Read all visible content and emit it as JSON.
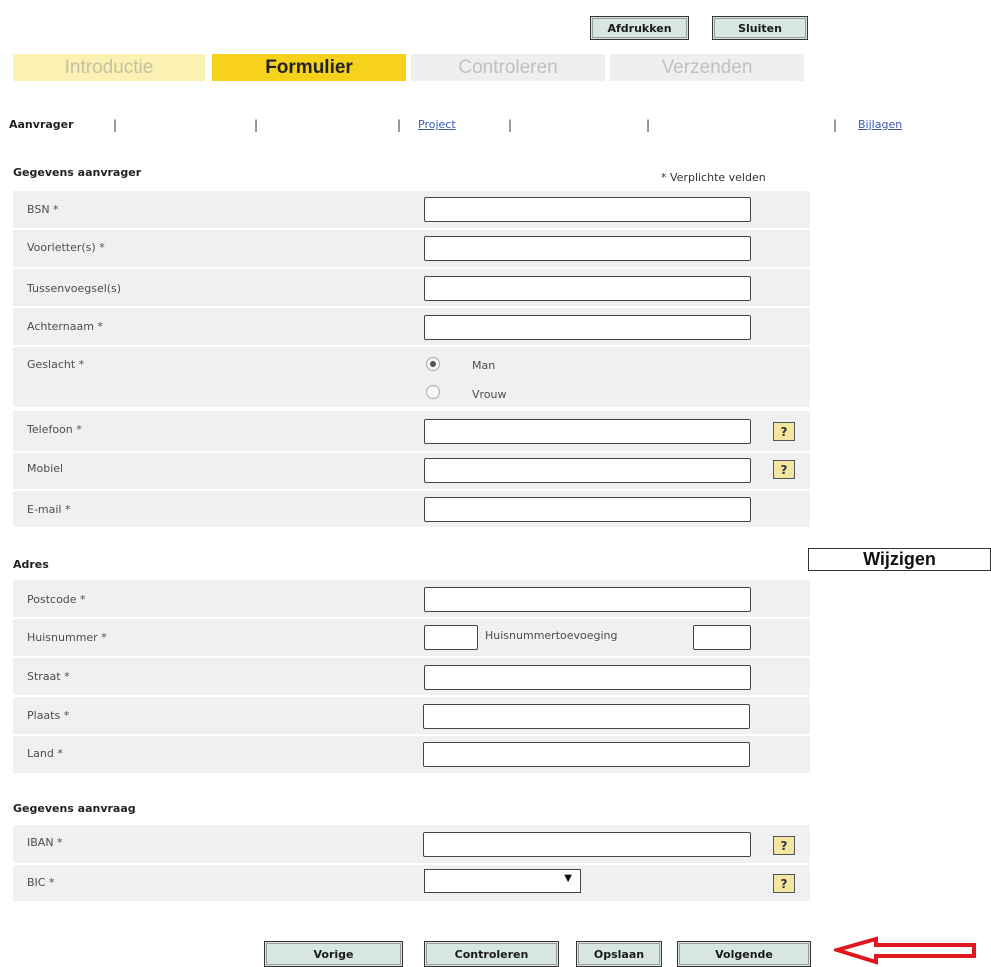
{
  "toolbar": {
    "print_label": "Afdrukken",
    "close_label": "Sluiten"
  },
  "steps": {
    "intro": "Introductie",
    "form": "Formulier",
    "check": "Controleren",
    "send": "Verzenden"
  },
  "subnav": {
    "applicant": "Aanvrager",
    "project": "Project",
    "attachments": "Bijlagen"
  },
  "section_applicant": {
    "title": "Gegevens aanvrager",
    "required_note": "* Verplichte velden",
    "bsn": "BSN *",
    "initials": "Voorletter(s) *",
    "prefix": "Tussenvoegsel(s)",
    "surname": "Achternaam *",
    "gender": "Geslacht *",
    "gender_male": "Man",
    "gender_female": "Vrouw",
    "phone": "Telefoon *",
    "mobile": "Mobiel",
    "email": "E-mail *"
  },
  "section_address": {
    "title": "Adres",
    "change_label": "Wijzigen",
    "postcode": "Postcode *",
    "house_number": "Huisnummer *",
    "house_number_addition": "Huisnummertoevoeging",
    "street": "Straat *",
    "city": "Plaats *",
    "country": "Land *"
  },
  "section_request": {
    "title": "Gegevens aanvraag",
    "iban": "IBAN *",
    "bic": "BIC *"
  },
  "help_symbol": "?",
  "footer": {
    "previous": "Vorige",
    "check": "Controleren",
    "save": "Opslaan",
    "next": "Volgende"
  },
  "colors": {
    "active_step": "#f6d21b",
    "button_bg": "#d7e6e2",
    "help_bg": "#f3e6a0",
    "arrow": "#e0171f"
  }
}
